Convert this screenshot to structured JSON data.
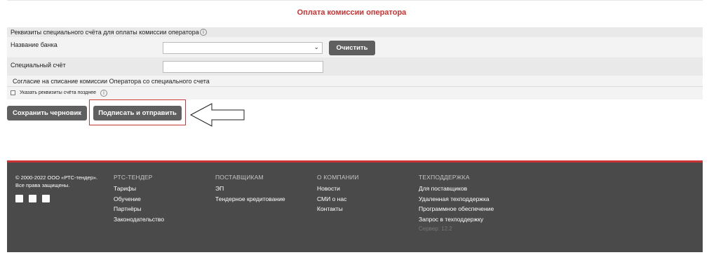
{
  "page": {
    "title": "Оплата комиссии оператора"
  },
  "section": {
    "header": "Реквизиты специального счёта для оплаты комиссии оператора",
    "bank_label": "Название банка",
    "bank_select_value": "",
    "clear_button": "Очистить",
    "account_label": "Специальный счёт",
    "account_value": "",
    "consent_header": "Согласие на списание комиссии Оператора со специального счета",
    "later_checkbox_label": "Указать реквизиты счёта позднее",
    "later_checked": false
  },
  "actions": {
    "save_draft": "Сохранить черновик",
    "sign_send": "Подписать и отправить"
  },
  "footer": {
    "copyright_line1": "© 2000-2022 ООО «РТС-тендер».",
    "copyright_line2": "Все права защищены.",
    "columns": [
      {
        "header": "РТС-ТЕНДЕР",
        "items": [
          "Тарифы",
          "Обучение",
          "Партнёры",
          "Законодательство"
        ]
      },
      {
        "header": "ПОСТАВЩИКАМ",
        "items": [
          "ЭП",
          "Тендерное кредитование"
        ]
      },
      {
        "header": "О КОМПАНИИ",
        "items": [
          "Новости",
          "СМИ о нас",
          "Контакты"
        ]
      },
      {
        "header": "ТЕХПОДДЕРЖКА",
        "items": [
          "Для поставщиков",
          "Удаленная техподдержка",
          "Программное обеспечение",
          "Запрос в техподдержку"
        ]
      }
    ],
    "server": "Сервер: 12.2"
  },
  "colors": {
    "accent_red": "#d23030",
    "button_gray": "#5f5f5f",
    "footer_bg": "#4a4a4a"
  },
  "icons": [
    "info-icon",
    "chevron-down-icon",
    "arrow-left-icon",
    "social-icon"
  ]
}
